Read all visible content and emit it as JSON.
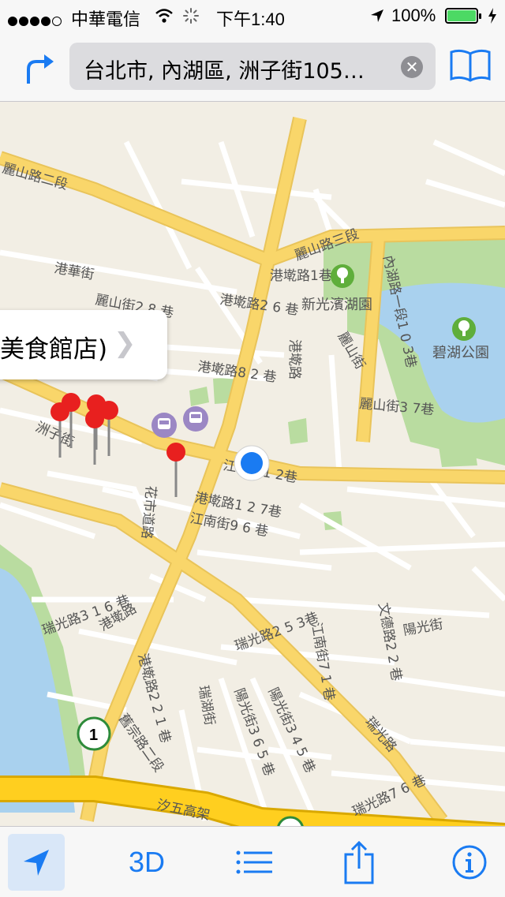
{
  "status_bar": {
    "carrier": "中華電信",
    "time": "下午1:40",
    "battery": "100%"
  },
  "nav": {
    "search_text": "台北市, 內湖區, 洲子街105…"
  },
  "map": {
    "road_labels": [
      "麗山路二段",
      "麗山路三段",
      "港華街",
      "港墘路1巷",
      "港墘路2 6 巷",
      "麗山街2 8 巷",
      "港墘路8 2 巷",
      "港墘路",
      "麗山街",
      "內湖路一段1 0 3巷",
      "麗山街3 7巷",
      "洲子街",
      "江南街1 2巷",
      "港墘路1 2 7巷",
      "江南街9 6 巷",
      "花市道路",
      "瑞光路3 1 6 巷",
      "港墘路",
      "瑞光路2 5 3巷",
      "江南街7 1 巷",
      "文德路2 2 巷",
      "陽光街",
      "港墘路2 2 1 巷",
      "瑞湖街",
      "陽光街3 6 5 巷",
      "陽光街3 4 5 巷",
      "舊宗路二段",
      "瑞光路",
      "汐五高架",
      "瑞光路7 6 巷"
    ],
    "park_labels": [
      "新光濱湖園",
      "碧湖公園"
    ],
    "route_shield": "1",
    "callout": {
      "text": "美食館店)"
    }
  },
  "toolbar": {
    "threed_label": "3D"
  },
  "colors": {
    "accent": "#1a7bf2",
    "road_major": "#f9d66a",
    "park": "#b9dca0",
    "water": "#a9d1ee",
    "pin": "#e8201f"
  }
}
